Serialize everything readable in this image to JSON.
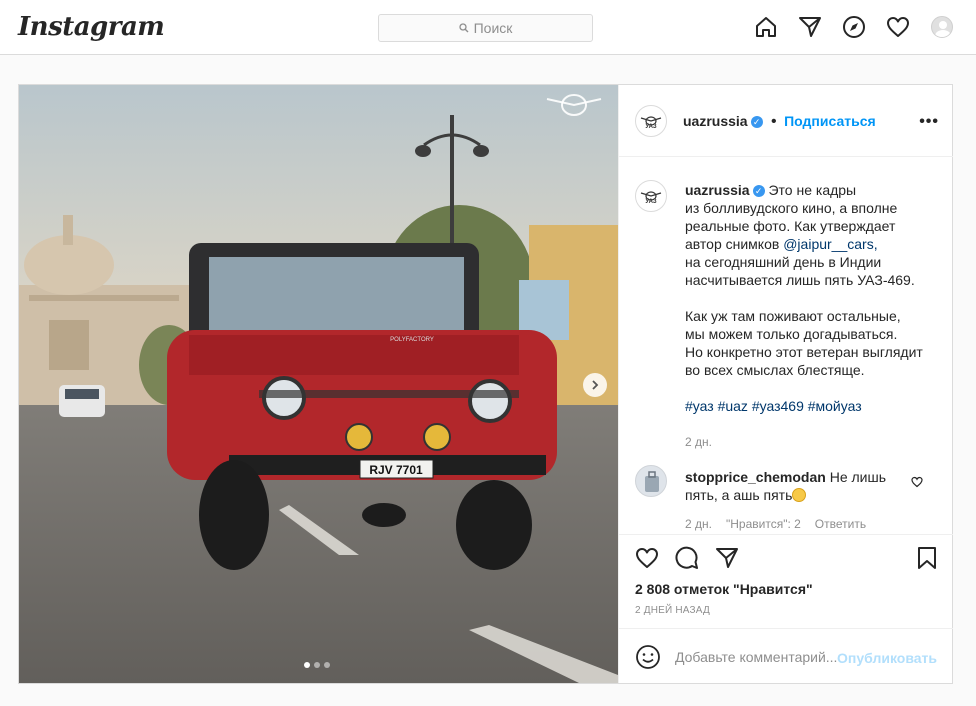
{
  "header": {
    "logo": "Instagram",
    "search_placeholder": "Поиск"
  },
  "post": {
    "username": "uazrussia",
    "separator": "•",
    "follow_label": "Подписаться",
    "more_label": "•••",
    "avatar_text": "УАЗ",
    "caption_lines": [
      "Это не кадры",
      "из болливудского кино, а вполне",
      "реальные фото. Как утверждает",
      "автор снимков",
      "@jaipur__cars,",
      "на сегодняшний день в Индии",
      "насчитывается лишь пять УАЗ-469.",
      "Как уж там поживают остальные,",
      "мы можем только догадываться.",
      "Но конкретно этот ветеран выглядит",
      "во всех смыслах блестяще.",
      "#уаз #uaz #уаз469 #мойуаз"
    ],
    "caption_age": "2 дн.",
    "plate": "RJV 7701",
    "bumper_text": "POLYFACTORY",
    "carousel_total": 3,
    "carousel_active": 1,
    "comment": {
      "username": "stopprice_chemodan",
      "text_line1": "Не лишь",
      "text_line2": "пять, а ашь пять",
      "age": "2 дн.",
      "likes": "\"Нравится\": 2",
      "reply_label": "Ответить"
    },
    "likes": "2 808 отметок \"Нравится\"",
    "date": "2 ДНЕЙ НАЗАД",
    "comment_placeholder": "Добавьте комментарий...",
    "publish_label": "Опубликовать"
  },
  "colors": {
    "accent": "#0095f6",
    "publish_disabled": "#b2dffc",
    "border": "#dbdbdb",
    "background": "#fafafa",
    "jeep_red": "#b2272b"
  }
}
